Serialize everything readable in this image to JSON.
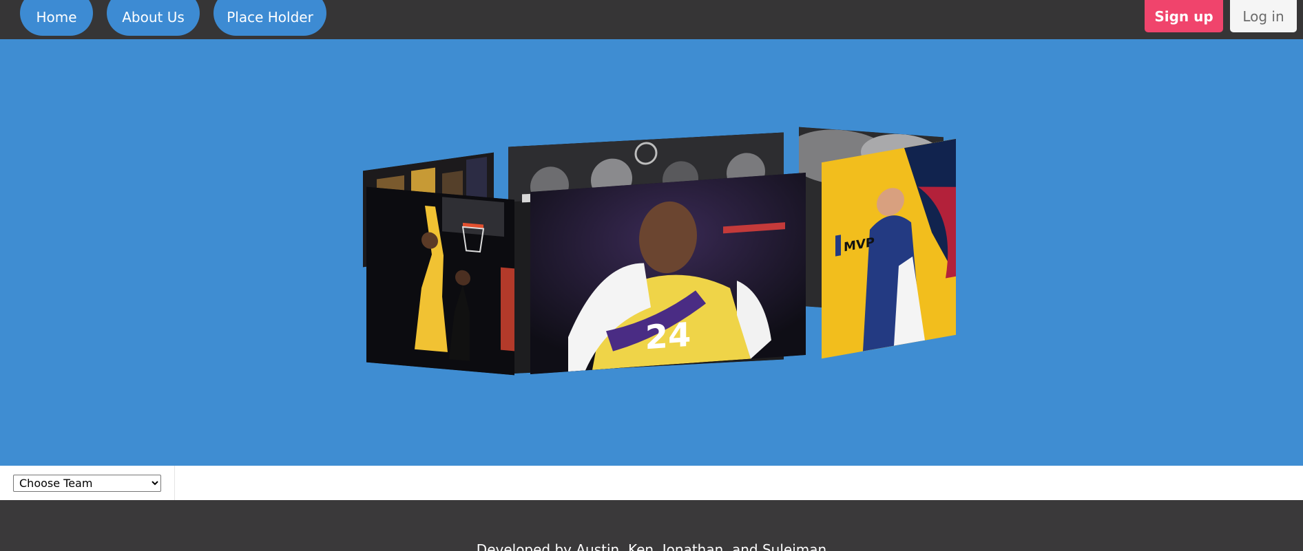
{
  "nav": {
    "items": [
      {
        "label": "Home"
      },
      {
        "label": "About Us"
      },
      {
        "label": "Place Holder"
      }
    ],
    "signup_label": "Sign up",
    "login_label": "Log in"
  },
  "hero": {
    "slides": [
      {
        "subject": "Lakers player dunking over defender"
      },
      {
        "subject": "Kobe Bryant number 24 with towel"
      },
      {
        "subject": "Nuggets MVP poster"
      }
    ],
    "kobe_jersey_number": "24",
    "mvp_badge": "MVP"
  },
  "filter": {
    "team_select_value": "Choose Team"
  },
  "footer": {
    "credit": "Developed by Austin, Ken, Jonathan, and Suleiman"
  },
  "colors": {
    "topbar": "#363536",
    "nav_pill": "#3d8bd3",
    "hero_bg": "#3f8dd2",
    "signup": "#f0446c",
    "login": "#f5f5f5",
    "footer": "#3a393a"
  }
}
